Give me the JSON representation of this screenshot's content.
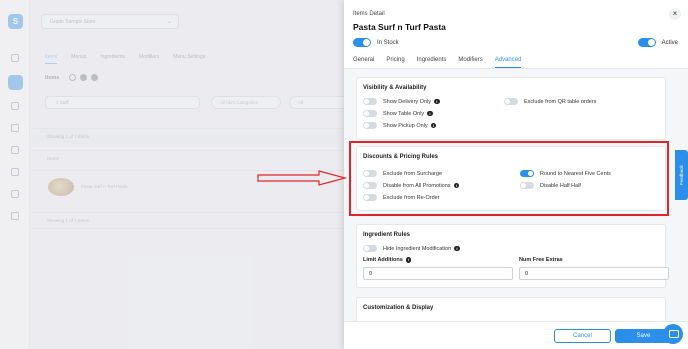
{
  "background": {
    "store_select": "Grade Sample Store",
    "tabs": [
      "Items",
      "Menus",
      "Ingredients",
      "Modifiers",
      "Menu Settings"
    ],
    "active_tab": "Items",
    "items_title": "Items",
    "search_value": "surf",
    "filter_pill_1": "All Item Categories",
    "filter_pill_2": "All",
    "showing_text": "Showing 1 of 1 Items",
    "column_name": "Name",
    "row_item": "Pasta Surf n Turf Pasta",
    "showing_text_bottom": "Showing 1 of 1 Items"
  },
  "drawer": {
    "kicker": "Items Detail",
    "title": "Pasta Surf n Turf Pasta",
    "in_stock_label": "In Stock",
    "active_label": "Active",
    "tabs": [
      "General",
      "Pricing",
      "Ingredients",
      "Modifiers",
      "Advanced"
    ],
    "selected_tab": "Advanced",
    "visibility": {
      "title": "Visibility & Availability",
      "show_delivery_only": "Show Delivery Only",
      "show_table_only": "Show Table Only",
      "show_pickup_only": "Show Pickup Only",
      "exclude_qr": "Exclude from QR table orders"
    },
    "discounts": {
      "title": "Discounts & Pricing Rules",
      "exclude_surcharge": "Exclude from Surcharge",
      "disable_promotions": "Disable from All Promotions",
      "exclude_reorder": "Exclude from Re-Order",
      "round_five_cents": "Round to Nearest Five Cents",
      "disable_half_half": "Disable Half Half"
    },
    "ingredients": {
      "title": "Ingredient Rules",
      "hide_modification": "Hide Ingredient Modification",
      "limit_additions_label": "Limit Additions",
      "limit_additions_value": "0",
      "num_free_extras_label": "Num Free Extras",
      "num_free_extras_value": "0"
    },
    "customization": {
      "title": "Customization & Display"
    },
    "cancel_label": "Cancel",
    "save_label": "Save"
  },
  "feedback_label": "Feedback",
  "colors": {
    "accent": "#2b8ee8",
    "highlight": "#e0242a"
  }
}
